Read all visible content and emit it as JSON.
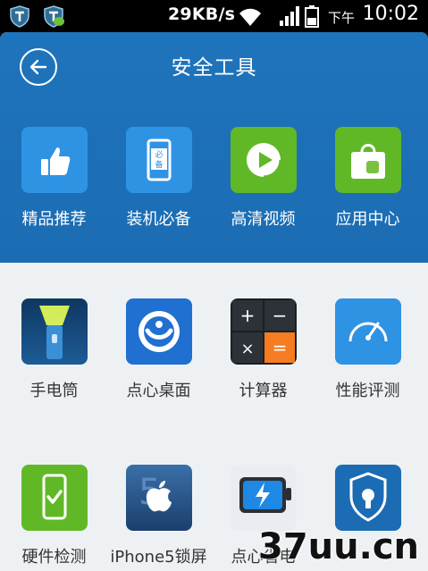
{
  "status_bar": {
    "speed": "29KB/s",
    "ampm": "下午",
    "time": "10:02",
    "icons": [
      "shield-app-icon",
      "shield-chat-icon",
      "wifi-icon",
      "signal-icon",
      "battery-icon"
    ]
  },
  "header": {
    "title": "安全工具",
    "back_icon": "arrow-left-icon",
    "tiles": [
      {
        "label": "精品推荐",
        "icon": "thumbs-up-icon",
        "color": "#2a8ee0"
      },
      {
        "label": "装机必备",
        "icon": "phone-badge-icon",
        "color": "#2a8ee0"
      },
      {
        "label": "高清视频",
        "icon": "play-icon",
        "color": "#5eb623"
      },
      {
        "label": "应用中心",
        "icon": "shopping-bag-icon",
        "color": "#5eb623"
      }
    ]
  },
  "grid": {
    "rows": [
      [
        {
          "label": "手电筒",
          "icon": "flashlight-icon"
        },
        {
          "label": "点心桌面",
          "icon": "dianxin-desktop-icon"
        },
        {
          "label": "计算器",
          "icon": "calculator-icon"
        },
        {
          "label": "性能评测",
          "icon": "speedometer-icon"
        }
      ],
      [
        {
          "label": "硬件检测",
          "icon": "phone-check-icon"
        },
        {
          "label": "iPhone5锁屏",
          "icon": "apple-icon"
        },
        {
          "label": "点心省电",
          "icon": "battery-bolt-icon"
        },
        {
          "label": "",
          "icon": "shield-lock-icon"
        }
      ]
    ]
  },
  "watermark": "37uu.cn"
}
